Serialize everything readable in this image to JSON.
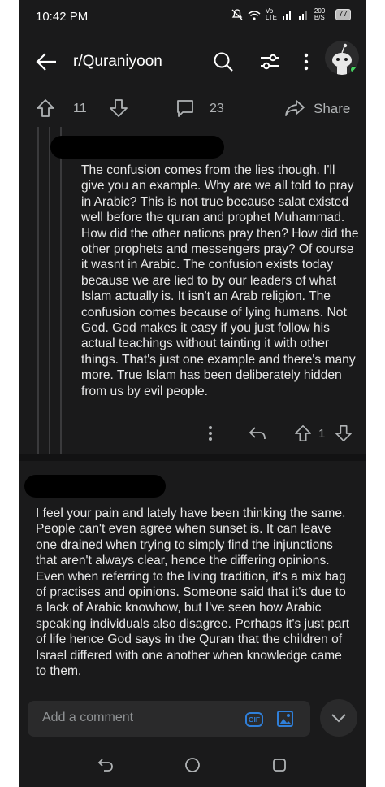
{
  "status_bar": {
    "time": "10:42 PM",
    "network": "Vo LTE",
    "speed": "200 B/S",
    "battery": "77",
    "icons": [
      "mute-icon",
      "wifi-icon",
      "signal-icon",
      "signal-icon",
      "battery-icon"
    ]
  },
  "app_bar": {
    "title": "r/Quraniyoon",
    "icons": [
      "back-arrow-icon",
      "search-icon",
      "filter-icon",
      "more-vertical-icon",
      "avatar"
    ]
  },
  "post_actions": {
    "upvotes": "11",
    "comments": "23",
    "share_label": "Share"
  },
  "comments": [
    {
      "author": "[redacted]",
      "body": "The confusion comes from the lies though. I'll give you an example. Why are we all told to pray in Arabic? This is not true because salat existed well before the quran and prophet Muhammad. How did the other nations pray then? How did the other prophets and messengers pray? Of course it wasnt in Arabic. The confusion exists today because we are lied to by our leaders of what Islam actually is. It isn't an Arab religion. The confusion comes because of lying humans. Not God. God makes it easy if you just follow his actual teachings without tainting it with other things. That's just one example and there's many more. True Islam has been deliberately hidden from us by evil people.",
      "score": "1"
    },
    {
      "author": "[redacted]",
      "body": "I feel your pain and lately have been thinking the same. People can't even agree when sunset is. It can leave one drained when trying to simply find the injunctions that aren't always clear, hence the differing opinions. Even when referring to the living tradition, it's a mix bag of practises and opinions. Someone said that it's due to a lack of Arabic knowhow, but I've seen how Arabic speaking individuals also disagree. Perhaps it's just part of life hence God says in the Quran that the children of Israel differed with one another when knowledge came to them."
    }
  ],
  "composer": {
    "placeholder": "Add a comment",
    "gif_label": "GIF"
  },
  "colors": {
    "background": "#1a1a1b",
    "text": "#e8e8e8",
    "muted": "#b0b3b5",
    "gif_accent": "#2f7fd9",
    "online": "#46d160"
  }
}
